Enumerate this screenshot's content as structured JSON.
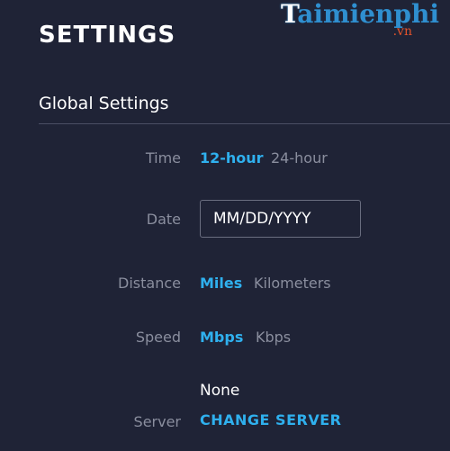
{
  "header": {
    "title": "SETTINGS"
  },
  "watermark": {
    "brand_initial": "T",
    "brand_rest": "aimienphi",
    "domain": ".vn"
  },
  "section": {
    "title": "Global Settings"
  },
  "time": {
    "label": "Time",
    "options": [
      "12-hour",
      "24-hour"
    ],
    "selected": "12-hour"
  },
  "date": {
    "label": "Date",
    "placeholder": "MM/DD/YYYY"
  },
  "distance": {
    "label": "Distance",
    "options": [
      "Miles",
      "Kilometers"
    ],
    "selected": "Miles"
  },
  "speed": {
    "label": "Speed",
    "options": [
      "Mbps",
      "Kbps"
    ],
    "selected": "Mbps"
  },
  "server": {
    "label": "Server",
    "value": "None",
    "change_label": "CHANGE SERVER"
  },
  "colors": {
    "background": "#1f2336",
    "accent": "#2fb0ee",
    "muted_text": "#8a8e9e",
    "divider": "#4a4f64"
  }
}
